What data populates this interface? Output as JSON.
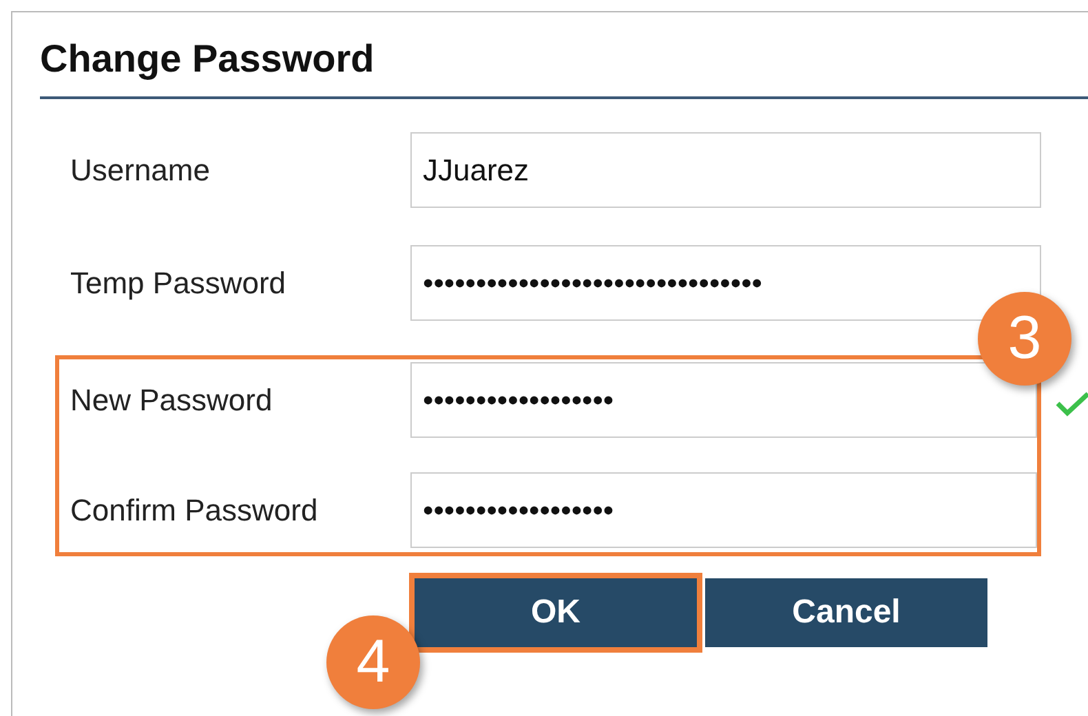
{
  "dialog": {
    "title": "Change Password"
  },
  "fields": [
    {
      "label": "Username",
      "value": "JJuarez",
      "highlighted": false,
      "valid": false
    },
    {
      "label": "Temp Password",
      "value": "••••••••••••••••••••••••••••••••",
      "highlighted": false,
      "valid": false
    },
    {
      "label": "New Password",
      "value": "••••••••••••••••••",
      "highlighted": true,
      "valid": true
    },
    {
      "label": "Confirm Password",
      "value": "••••••••••••••••••",
      "highlighted": true,
      "valid": false
    }
  ],
  "fields_callout": "3",
  "buttons": [
    {
      "label": "OK",
      "highlighted": true,
      "callout": "4"
    },
    {
      "label": "Cancel",
      "highlighted": false
    }
  ]
}
